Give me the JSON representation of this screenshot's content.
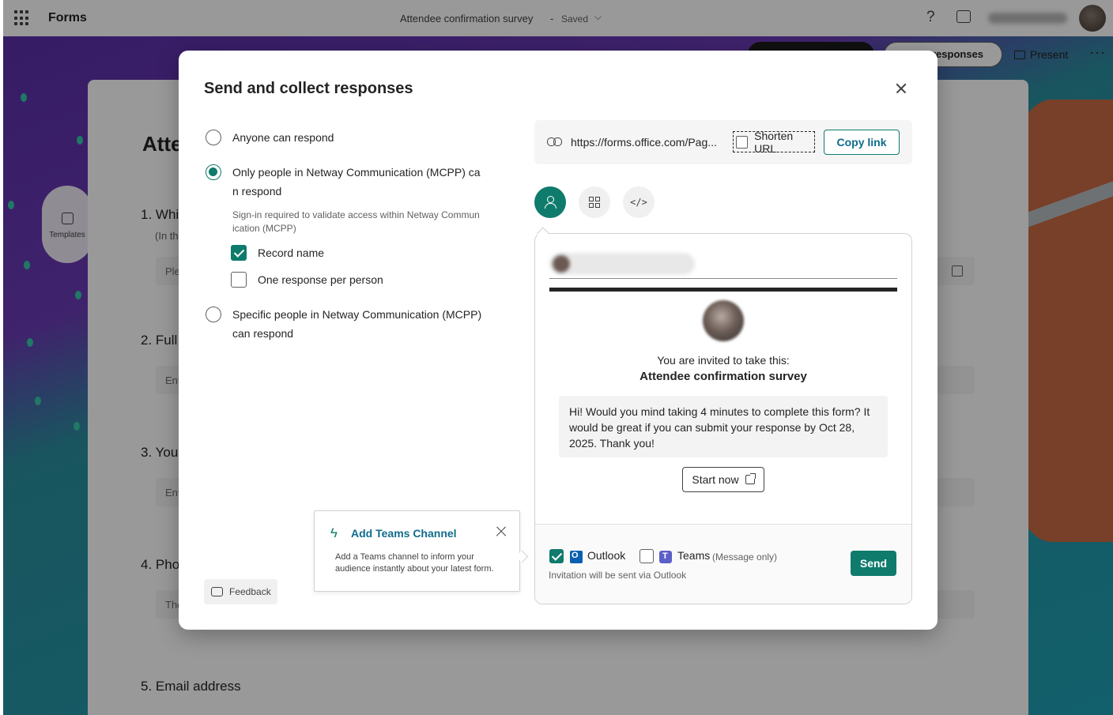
{
  "app": {
    "name": "Forms",
    "doc_title": "Attendee confirmation survey",
    "doc_sep": "-",
    "doc_status": "Saved",
    "toolbar_responses": "responses",
    "present_label": "Present",
    "more_label": "···",
    "templates_label": "Templates"
  },
  "form": {
    "title": "Atte",
    "questions": [
      {
        "label": "1. Whi",
        "sub": "(In th",
        "placeholder": "Ple"
      },
      {
        "label": "2. Full",
        "placeholder": "Ent"
      },
      {
        "label": "3. Your",
        "placeholder": "Ent"
      },
      {
        "label": "4. Pho",
        "placeholder": "The"
      },
      {
        "label": "5. Email address"
      }
    ]
  },
  "dialog": {
    "title": "Send and collect responses",
    "options": [
      {
        "label": "Anyone can respond",
        "selected": false
      },
      {
        "label_line1": "Only people in Netway Communication (MCPP) ca",
        "label_line2": "n respond",
        "selected": true,
        "desc_line1": "Sign-in required to validate access within Netway Commun",
        "desc_line2": "ication (MCPP)"
      },
      {
        "label_line1": "Specific people in Netway Communication (MCPP)",
        "label_line2": "can respond",
        "selected": false
      }
    ],
    "record_name": {
      "label": "Record name",
      "checked": true
    },
    "one_response": {
      "label": "One response per person",
      "checked": false
    },
    "feedback_label": "Feedback",
    "teams_popup": {
      "title": "Add Teams Channel",
      "desc": "Add a Teams channel to inform your audience instantly about your latest form."
    },
    "link": {
      "url": "https://forms.office.com/Pag...",
      "shorten_label": "Shorten URL",
      "shorten_checked": false,
      "copy_label": "Copy link"
    },
    "share_tabs": [
      {
        "icon": "invite-people-icon",
        "selected": true
      },
      {
        "icon": "qr-code-icon",
        "selected": false
      },
      {
        "icon": "embed-code-icon",
        "selected": false
      }
    ],
    "preview": {
      "invite_text": "You are invited to take this:",
      "form_name": "Attendee confirmation survey",
      "message": "Hi! Would you mind taking 4 minutes to complete this form? It would be great if you can submit your response by Oct 28, 2025. Thank you!",
      "start_label": "Start now"
    },
    "channels": {
      "outlook": {
        "label": "Outlook",
        "checked": true
      },
      "teams": {
        "label": "Teams",
        "note": "(Message only)",
        "checked": false
      },
      "hint": "Invitation will be sent via Outlook",
      "send_label": "Send"
    }
  },
  "colors": {
    "accent": "#0f7b6c",
    "link_text": "#0f6c8c"
  }
}
